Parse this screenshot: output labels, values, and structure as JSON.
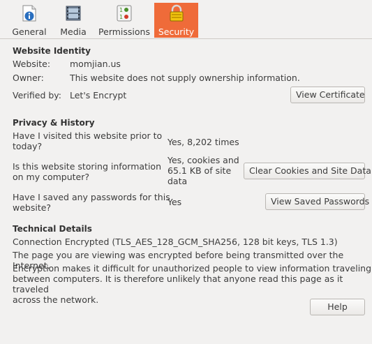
{
  "tabs": [
    {
      "label": "General",
      "icon": "info-icon"
    },
    {
      "label": "Media",
      "icon": "media-icon"
    },
    {
      "label": "Permissions",
      "icon": "permissions-icon"
    },
    {
      "label": "Security",
      "icon": "lock-icon",
      "active": true
    }
  ],
  "identity": {
    "title": "Website Identity",
    "website_label": "Website:",
    "website_value": "momjian.us",
    "owner_label": "Owner:",
    "owner_value": "This website does not supply ownership information.",
    "verified_label": "Verified by:",
    "verified_value": "Let's Encrypt",
    "view_certificate_button": "View Certificate"
  },
  "privacy": {
    "title": "Privacy & History",
    "visited_question_l1": "Have I visited this website prior to",
    "visited_question_l2": "today?",
    "visited_answer": "Yes, 8,202 times",
    "storing_question_l1": "Is this website storing information",
    "storing_question_l2": "on my computer?",
    "storing_answer_l1": "Yes, cookies and",
    "storing_answer_l2": "65.1 KB of site",
    "storing_answer_l3": "data",
    "clear_cookies_button": "Clear Cookies and Site Data",
    "passwords_question_l1": "Have I saved any passwords for this",
    "passwords_question_l2": "website?",
    "passwords_answer": "Yes",
    "view_passwords_button": "View Saved Passwords"
  },
  "technical": {
    "title": "Technical Details",
    "connection": "Connection Encrypted (TLS_AES_128_GCM_SHA256, 128 bit keys, TLS 1.3)",
    "encrypted_statement": "The page you are viewing was encrypted before being transmitted over the Internet.",
    "explanation_l1": "Encryption makes it difficult for unauthorized people to view information traveling",
    "explanation_l2": "between computers. It is therefore unlikely that anyone read this page as it traveled",
    "explanation_l3": "across the network."
  },
  "help_button": "Help",
  "colors": {
    "active_tab": "#ef6b39",
    "window_bg": "#f2f1f0"
  }
}
